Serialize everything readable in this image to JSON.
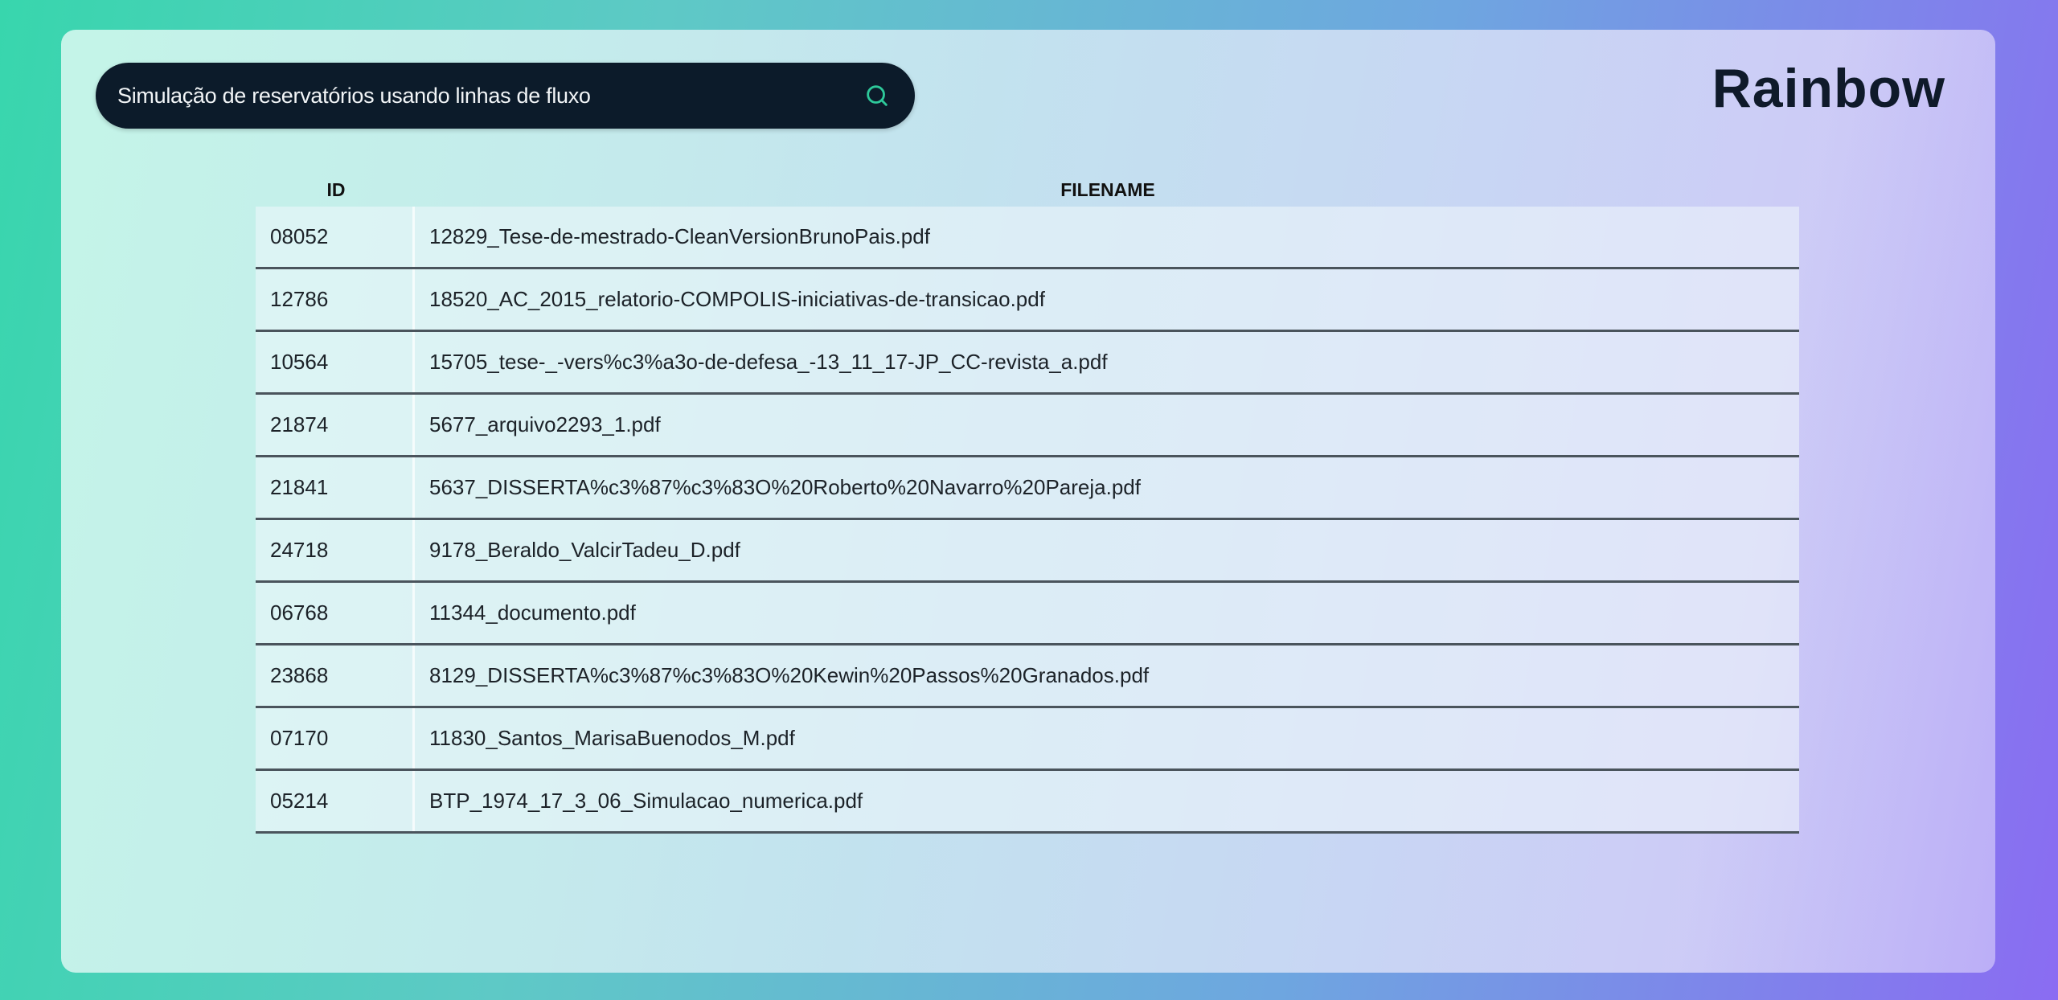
{
  "search": {
    "query": "Simulação de reservatórios usando linhas de fluxo",
    "icon": "search-icon"
  },
  "brand": "Rainbow",
  "table": {
    "headers": [
      "ID",
      "FILENAME"
    ],
    "rows": [
      {
        "id": "08052",
        "filename": "12829_Tese-de-mestrado-CleanVersionBrunoPais.pdf"
      },
      {
        "id": "12786",
        "filename": "18520_AC_2015_relatorio-COMPOLIS-iniciativas-de-transicao.pdf"
      },
      {
        "id": "10564",
        "filename": "15705_tese-_-vers%c3%a3o-de-defesa_-13_11_17-JP_CC-revista_a.pdf"
      },
      {
        "id": "21874",
        "filename": "5677_arquivo2293_1.pdf"
      },
      {
        "id": "21841",
        "filename": "5637_DISSERTA%c3%87%c3%83O%20Roberto%20Navarro%20Pareja.pdf"
      },
      {
        "id": "24718",
        "filename": "9178_Beraldo_ValcirTadeu_D.pdf"
      },
      {
        "id": "06768",
        "filename": "11344_documento.pdf"
      },
      {
        "id": "23868",
        "filename": "8129_DISSERTA%c3%87%c3%83O%20Kewin%20Passos%20Granados.pdf"
      },
      {
        "id": "07170",
        "filename": "11830_Santos_MarisaBuenodos_M.pdf"
      },
      {
        "id": "05214",
        "filename": "BTP_1974_17_3_06_Simulacao_numerica.pdf"
      }
    ]
  },
  "colors": {
    "search_bg": "#0c1b2a",
    "search_icon": "#2ec99a",
    "brand_text": "#0f1a2a"
  }
}
